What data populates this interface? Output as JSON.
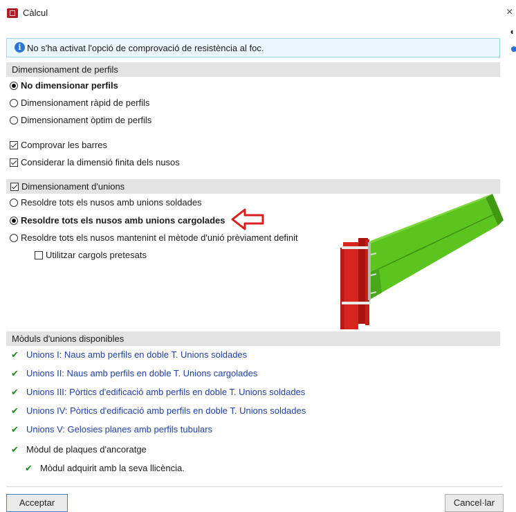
{
  "window": {
    "title": "Càlcul",
    "close_glyph": "×"
  },
  "info": {
    "text": "No s'ha activat l'opció de comprovació de resistència al foc."
  },
  "profiles": {
    "header": "Dimensionament de perfils",
    "options": [
      {
        "label": "No dimensionar perfils",
        "selected": true
      },
      {
        "label": "Dimensionament ràpid de perfils",
        "selected": false
      },
      {
        "label": "Dimensionament òptim de perfils",
        "selected": false
      }
    ],
    "checks": [
      {
        "label": "Comprovar les barres",
        "checked": true
      },
      {
        "label": "Considerar la dimensió finita dels nusos",
        "checked": true
      }
    ]
  },
  "unions": {
    "header": "Dimensionament d'unions",
    "header_checked": true,
    "options": [
      {
        "label": "Resoldre tots els nusos amb unions soldades",
        "selected": false
      },
      {
        "label": "Resoldre tots els nusos amb unions cargolades",
        "selected": true
      },
      {
        "label": "Resoldre tots els nusos mantenint el mètode d'unió prèviament definit",
        "selected": false
      }
    ],
    "pretensioned": {
      "label": "Utilitzar cargols pretesats",
      "checked": false
    }
  },
  "modules": {
    "header": "Mòduls d'unions disponibles",
    "items": [
      "Unions I: Naus amb perfils en doble T. Unions soldades",
      "Unions II: Naus amb perfils en doble T. Unions cargolades",
      "Unions III: Pòrtics d'edificació amb perfils en doble T. Unions soldades",
      "Unions IV: Pòrtics d'edificació amb perfils en doble T. Unions soldades",
      "Unions V: Gelosies planes amb perfils tubulars"
    ],
    "anchor_module": "Mòdul de plaques d'ancoratge",
    "license_note": "Mòdul adquirit amb la seva llicència."
  },
  "buttons": {
    "accept": "Acceptar",
    "cancel": "Cancel·lar"
  },
  "icons": {
    "tick": "✔",
    "info": "i"
  },
  "colors": {
    "beam_green": "#5cc41f",
    "column_red": "#d6241e",
    "arrow_red": "#d81e1e",
    "link_blue": "#1f3fa8",
    "tick_green": "#1f8a1f"
  }
}
